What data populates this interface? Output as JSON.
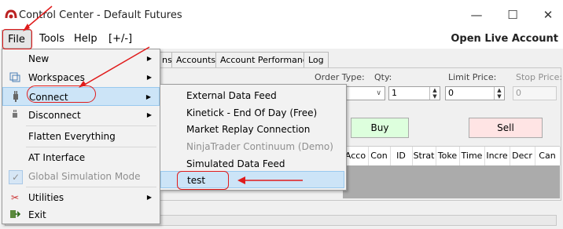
{
  "window": {
    "title": "Control Center - Default Futures",
    "minimize_glyph": "—",
    "maximize_glyph": "☐",
    "close_glyph": "✕"
  },
  "menubar": {
    "items": [
      "File",
      "Tools",
      "Help",
      "[+/-]"
    ],
    "right_link": "Open Live Account"
  },
  "tabs": [
    "ns",
    "Accounts",
    "Account Performance",
    "Log"
  ],
  "order_entry": {
    "order_type_label": "Order Type:",
    "qty_label": "Qty:",
    "qty_value": "1",
    "limit_price_label": "Limit Price:",
    "limit_price_value": "0",
    "stop_price_label": "Stop Price:",
    "stop_price_value": "0",
    "buy_label": "Buy",
    "sell_label": "Sell"
  },
  "grid_columns": [
    "Acco",
    "Con",
    "ID",
    "Strat",
    "Toke",
    "Time",
    "Incre",
    "Decr",
    "Can"
  ],
  "file_menu": {
    "items": [
      {
        "label": "New",
        "icon": "blank",
        "submenu": true
      },
      {
        "label": "Workspaces",
        "icon": "window-icon",
        "submenu": true
      },
      {
        "label": "Connect",
        "icon": "plug-icon",
        "submenu": true,
        "highlighted": true
      },
      {
        "label": "Disconnect",
        "icon": "unplug-icon",
        "submenu": true
      },
      {
        "label": "Flatten Everything",
        "icon": "blank",
        "submenu": false
      },
      {
        "label": "AT Interface",
        "icon": "blank",
        "submenu": false
      },
      {
        "label": "Global Simulation Mode",
        "icon": "checkmark-icon",
        "submenu": false,
        "disabled": true
      },
      {
        "label": "Utilities",
        "icon": "tools-icon",
        "submenu": true
      },
      {
        "label": "Exit",
        "icon": "exit-icon",
        "submenu": false
      }
    ]
  },
  "connect_submenu": {
    "items": [
      {
        "label": "External Data Feed"
      },
      {
        "label": "Kinetick - End Of Day (Free)"
      },
      {
        "label": "Market Replay Connection"
      },
      {
        "label": "NinjaTrader Continuum (Demo)",
        "disabled": true
      },
      {
        "label": "Simulated Data Feed"
      },
      {
        "label": "test",
        "highlighted": true
      }
    ]
  },
  "colors": {
    "highlight": "#cce4f7",
    "annotation_red": "#e01b1b",
    "buy_bg": "#ddffdd",
    "sell_bg": "#ffe4e4"
  }
}
